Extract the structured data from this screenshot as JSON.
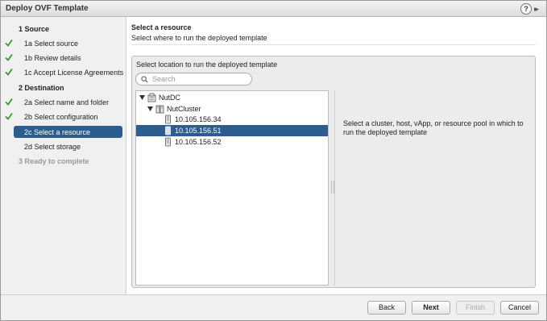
{
  "window": {
    "title": "Deploy OVF Template",
    "help_label": "?",
    "expand_label": "▸▸"
  },
  "nav": {
    "items": [
      {
        "label": "1  Source",
        "kind": "section",
        "check": false,
        "state": "normal"
      },
      {
        "label": "1a  Select source",
        "kind": "step",
        "check": true,
        "state": "normal"
      },
      {
        "label": "1b  Review details",
        "kind": "step",
        "check": true,
        "state": "normal"
      },
      {
        "label": "1c  Accept License Agreements",
        "kind": "step",
        "check": true,
        "state": "normal"
      },
      {
        "label": "2  Destination",
        "kind": "section",
        "check": false,
        "state": "normal"
      },
      {
        "label": "2a  Select name and folder",
        "kind": "step",
        "check": true,
        "state": "normal"
      },
      {
        "label": "2b  Select configuration",
        "kind": "step",
        "check": true,
        "state": "normal"
      },
      {
        "label": "2c  Select a resource",
        "kind": "step",
        "check": false,
        "state": "active"
      },
      {
        "label": "2d  Select storage",
        "kind": "step",
        "check": false,
        "state": "normal"
      },
      {
        "label": "3  Ready to complete",
        "kind": "section",
        "check": false,
        "state": "disabled"
      }
    ]
  },
  "main": {
    "heading": "Select a resource",
    "subheading": "Select where to run the deployed template",
    "panel_title": "Select location to run the deployed template",
    "search": {
      "placeholder": "Search",
      "value": ""
    },
    "tree": [
      {
        "label": "NutDC",
        "icon": "datacenter-icon",
        "expanded": true,
        "level": 0,
        "selected": false
      },
      {
        "label": "NutCluster",
        "icon": "cluster-icon",
        "expanded": true,
        "level": 1,
        "selected": false
      },
      {
        "label": "10.105.156.34",
        "icon": "host-icon",
        "expanded": false,
        "level": 2,
        "selected": false
      },
      {
        "label": "10.105.156.51",
        "icon": "host-icon",
        "expanded": false,
        "level": 2,
        "selected": true
      },
      {
        "label": "10.105.156.52",
        "icon": "host-icon",
        "expanded": false,
        "level": 2,
        "selected": false
      }
    ],
    "info_text": "Select a cluster, host, vApp, or resource pool in which to run the deployed template"
  },
  "footer": {
    "back_label": "Back",
    "next_label": "Next",
    "finish_label": "Finish",
    "cancel_label": "Cancel"
  },
  "colors": {
    "accent": "#2d5c8f",
    "check": "#3a9a2e"
  }
}
